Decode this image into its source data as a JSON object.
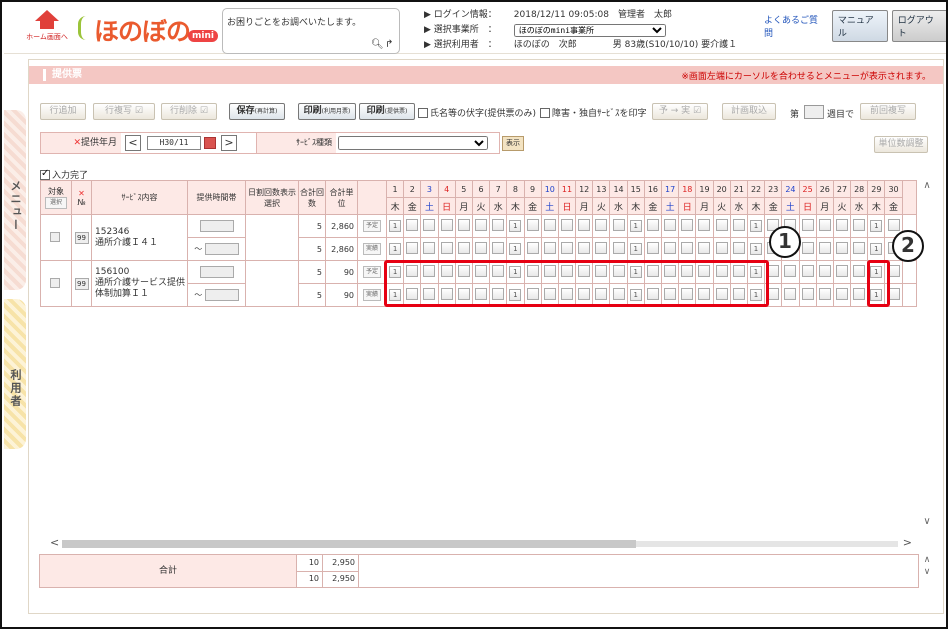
{
  "header": {
    "home_label": "ホーム画面へ",
    "logo_text": "ほのぼの",
    "logo_badge": "mini",
    "help_placeholder": "お困りごとをお調べいたします。",
    "login_label": "ログイン情報：",
    "login_value": "2018/12/11 09:05:08　管理者　太郎",
    "office_label": "選択事業所　：",
    "office_value": "ほのぼのmini事業所",
    "user_label": "選択利用者　：",
    "user_value": "ほのぼの　次郎　　　　男 83歳(S10/10/10) 要介護１",
    "faq": "よくあるご質問",
    "manual": "マニュアル",
    "logout": "ログアウト"
  },
  "side": {
    "menu": "メニュー",
    "users": "利用者"
  },
  "titlebar": {
    "title": "提供票",
    "note": "※画面左端にカーソルを合わせるとメニューが表示されます。"
  },
  "toolbar": {
    "add_row": "行追加",
    "copy_row": "行複写",
    "delete_row": "行削除",
    "save": "保存",
    "save_sub": "(再計算)",
    "print1": "印刷",
    "print1_sub": "(利用月票)",
    "print2": "印刷",
    "print2_sub": "(提供票)",
    "hide_name": "氏名等の伏字(提供票のみ)",
    "print_disability": "障害・独自ｻｰﾋﾞｽを印字",
    "plan_to_actual": "予 → 実",
    "plan_import": "計画取込",
    "week_prefix": "第",
    "week_suffix": "週目で",
    "copy_prev": "前回複写"
  },
  "conditions": {
    "month_label": "提供年月",
    "required_mark": "✕",
    "month_value": "H30/11",
    "service_label": "ｻｰﾋﾞｽ種類",
    "display": "表示",
    "unit_adjust": "単位数調整",
    "input_done": "入力完了"
  },
  "table": {
    "headers": {
      "target": "対象",
      "select": "選択",
      "no": "№",
      "service": "ｻｰﾋﾞｽ内容",
      "time": "提供時間帯",
      "daily": "日割回数表示選択",
      "count": "合計回数",
      "units": "合計単位"
    },
    "days": [
      "1",
      "2",
      "3",
      "4",
      "5",
      "6",
      "7",
      "8",
      "9",
      "10",
      "11",
      "12",
      "13",
      "14",
      "15",
      "16",
      "17",
      "18",
      "19",
      "20",
      "21",
      "22",
      "23",
      "24",
      "25",
      "26",
      "27",
      "28",
      "29",
      "30"
    ],
    "weekdays": [
      "木",
      "金",
      "土",
      "日",
      "月",
      "火",
      "水",
      "木",
      "金",
      "土",
      "日",
      "月",
      "火",
      "水",
      "木",
      "金",
      "土",
      "日",
      "月",
      "火",
      "水",
      "木",
      "金",
      "土",
      "日",
      "月",
      "火",
      "水",
      "木",
      "金"
    ],
    "rows": [
      {
        "code": "152346",
        "name": "通所介護Ｉ４１",
        "no": "99",
        "tilde": "～",
        "plan": {
          "count": "5",
          "units": "2,860",
          "label": "予定",
          "days": [
            "1",
            "",
            "",
            "",
            "",
            "",
            "",
            "1",
            "",
            "",
            "",
            "",
            "",
            "",
            "1",
            "",
            "",
            "",
            "",
            "",
            "",
            "1",
            "",
            "",
            "",
            "",
            "",
            "",
            "1",
            ""
          ]
        },
        "actual": {
          "count": "5",
          "units": "2,860",
          "label": "実績",
          "days": [
            "1",
            "",
            "",
            "",
            "",
            "",
            "",
            "1",
            "",
            "",
            "",
            "",
            "",
            "",
            "1",
            "",
            "",
            "",
            "",
            "",
            "",
            "1",
            "",
            "",
            "",
            "",
            "",
            "",
            "1",
            ""
          ]
        }
      },
      {
        "code": "156100",
        "name": "通所介護サービス提供体制加算Ｉ１",
        "no": "99",
        "tilde": "～",
        "plan": {
          "count": "5",
          "units": "90",
          "label": "予定",
          "days": [
            "1",
            "",
            "",
            "",
            "",
            "",
            "",
            "1",
            "",
            "",
            "",
            "",
            "",
            "",
            "1",
            "",
            "",
            "",
            "",
            "",
            "",
            "1",
            "",
            "",
            "",
            "",
            "",
            "",
            "1",
            ""
          ]
        },
        "actual": {
          "count": "5",
          "units": "90",
          "label": "実績",
          "days": [
            "1",
            "",
            "",
            "",
            "",
            "",
            "",
            "1",
            "",
            "",
            "",
            "",
            "",
            "",
            "1",
            "",
            "",
            "",
            "",
            "",
            "",
            "1",
            "",
            "",
            "",
            "",
            "",
            "",
            "1",
            ""
          ]
        }
      }
    ]
  },
  "totals": {
    "label": "合計",
    "count1": "10",
    "units1": "2,950",
    "count2": "10",
    "units2": "2,950"
  },
  "callouts": {
    "one": "1",
    "two": "2"
  },
  "colors": {
    "highlight": "#e60012",
    "header_pink": "#fde9e6",
    "title_pink": "#f4c7c3",
    "saturday": "#2244cc",
    "sunday": "#dd2222"
  }
}
